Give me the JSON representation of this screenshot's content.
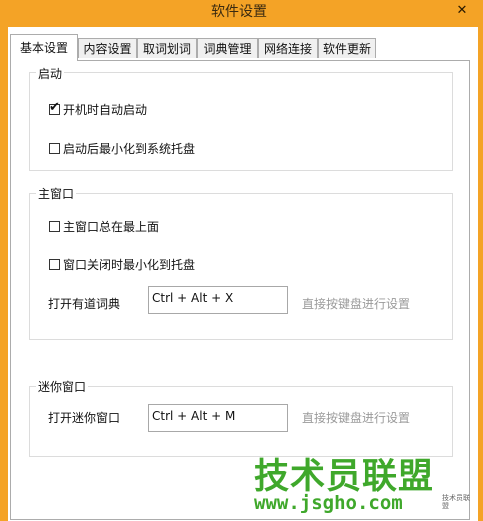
{
  "window": {
    "title": "软件设置",
    "close_glyph": "✕"
  },
  "tabs": [
    {
      "label": "基本设置",
      "active": true
    },
    {
      "label": "内容设置",
      "active": false
    },
    {
      "label": "取词划词",
      "active": false
    },
    {
      "label": "词典管理",
      "active": false
    },
    {
      "label": "网络连接",
      "active": false
    },
    {
      "label": "软件更新",
      "active": false
    }
  ],
  "startup": {
    "label": "启动",
    "auto_start": {
      "label": "开机时自动启动",
      "checked": true
    },
    "minimize_tray": {
      "label": "启动后最小化到系统托盘",
      "checked": false
    }
  },
  "main_window": {
    "label": "主窗口",
    "always_on_top": {
      "label": "主窗口总在最上面",
      "checked": false
    },
    "close_to_tray": {
      "label": "窗口关闭时最小化到托盘",
      "checked": false
    },
    "open_dict_label": "打开有道词典",
    "open_dict_hotkey": "Ctrl + Alt + X",
    "hint": "直接按键盘进行设置"
  },
  "mini_window": {
    "label": "迷你窗口",
    "open_mini_label": "打开迷你窗口",
    "open_mini_hotkey": "Ctrl + Alt + M",
    "hint": "直接按键盘进行设置"
  },
  "watermark": {
    "brand": "技术员联盟",
    "url": "www.jsgho.com",
    "small": "技术员联盟"
  }
}
